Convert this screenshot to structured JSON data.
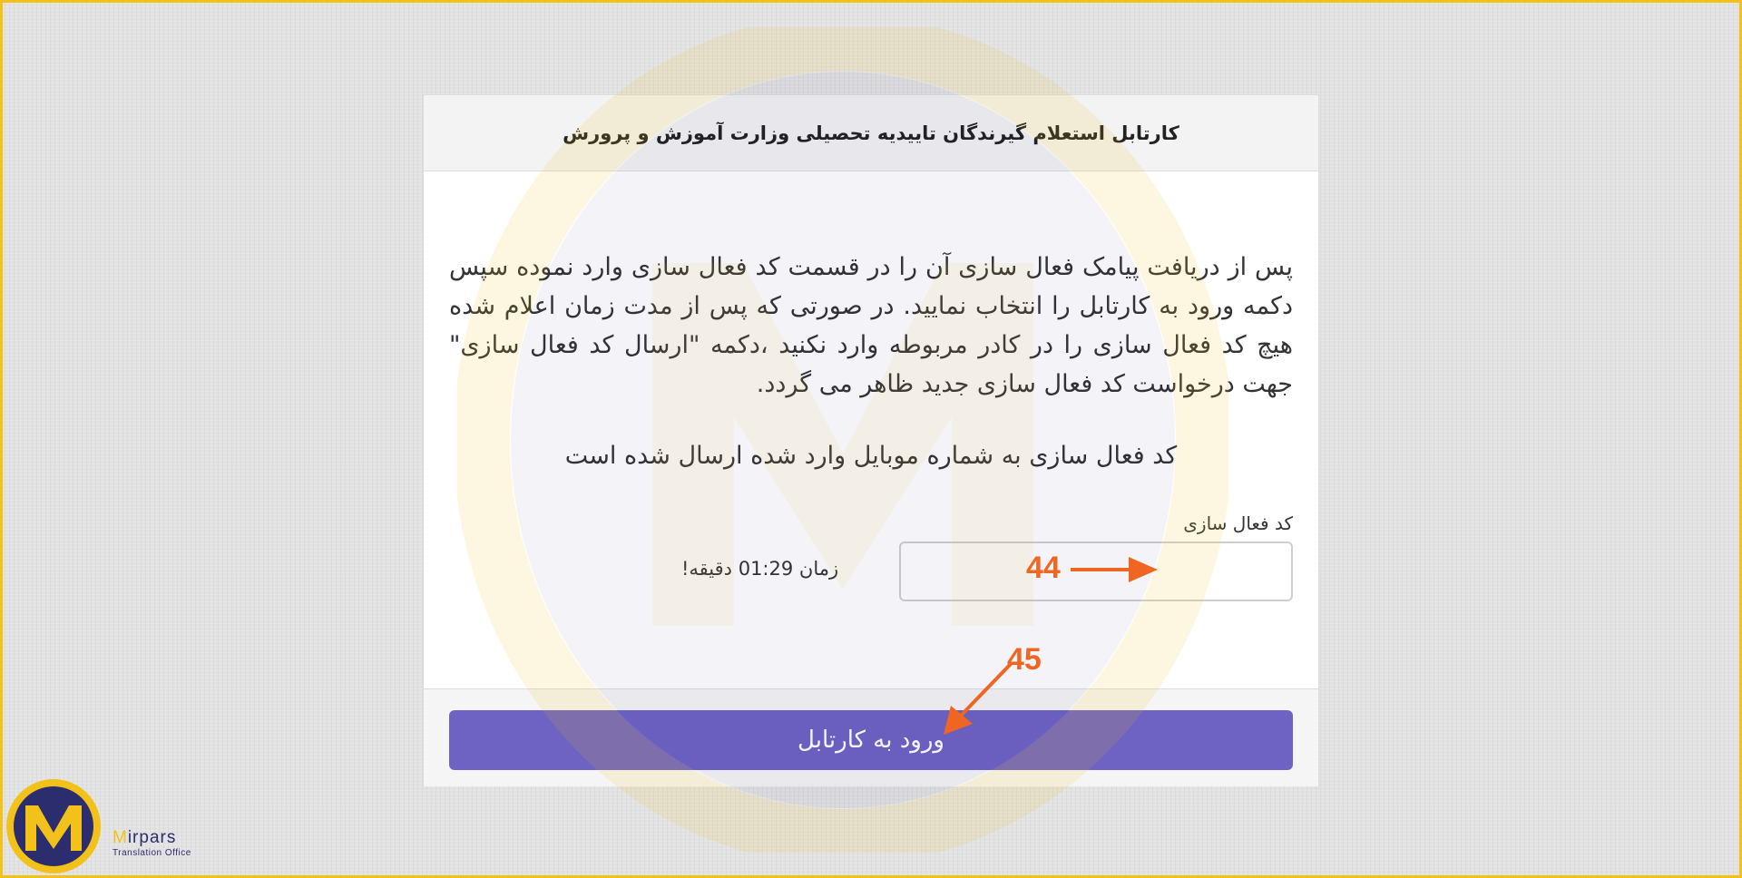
{
  "header": {
    "title": "کارتابل استعلام گیرندگان تاییدیه تحصیلی وزارت آموزش و پرورش"
  },
  "instructions": {
    "text": "پس از دریافت پیامک فعال سازی آن را در قسمت کد فعال سازی وارد نموده سپس دکمه ورود به کارتابل را انتخاب نمایید. در صورتی که پس از مدت زمان اعلام شده هیچ کد فعال سازی را در کادر مربوطه وارد نکنید ،دکمه \"ارسال کد فعال سازی\" جهت درخواست کد فعال سازی جدید ظاهر می گردد."
  },
  "sent_note": "کد فعال سازی به شماره موبایل وارد شده ارسال شده است",
  "form": {
    "code_label": "کد فعال سازی",
    "code_value": "",
    "timer_text": "زمان 01:29 دقیقه!",
    "submit_label": "ورود به کارتابل"
  },
  "annotations": {
    "callout_44": "44",
    "callout_45": "45"
  },
  "logo": {
    "name_first": "M",
    "name_rest": "irpars",
    "subtitle": "Translation Office"
  },
  "colors": {
    "frame": "#f2c21a",
    "primary_button": "#6e63c3",
    "callout": "#ef6622",
    "logo_navy": "#2b2d6e",
    "logo_gold": "#f2c21a"
  },
  "icons": {
    "arrow_44": "arrow-right-icon",
    "arrow_45": "arrow-down-left-icon",
    "logo": "mirpars-logo-icon",
    "watermark": "mirpars-watermark-icon"
  }
}
